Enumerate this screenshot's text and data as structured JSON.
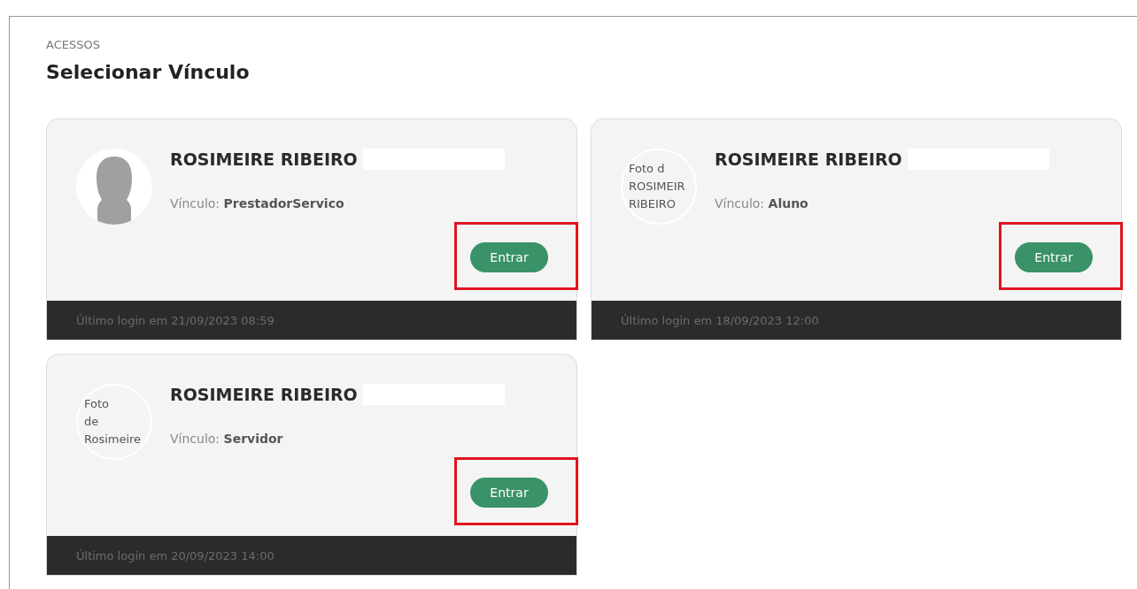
{
  "breadcrumb": "ACESSOS",
  "title": "Selecionar Vínculo",
  "cards": [
    {
      "name": "ROSIMEIRE RIBEIRO",
      "avatar": {
        "kind": "silhouette"
      },
      "link_label": "Vínculo:",
      "link_value": "PrestadorServico",
      "button": "Entrar",
      "highlighted": true,
      "last_login": "Último login em 21/09/2023 08:59"
    },
    {
      "name": "ROSIMEIRE RIBEIRO",
      "avatar": {
        "kind": "broken-image",
        "alt_lines": [
          "Foto d",
          "ROSIMEIR",
          "RIBEIRO"
        ]
      },
      "link_label": "Vínculo:",
      "link_value": "Aluno",
      "button": "Entrar",
      "highlighted": true,
      "last_login": "Último login em 18/09/2023 12:00"
    },
    {
      "name": "ROSIMEIRE RIBEIRO",
      "avatar": {
        "kind": "broken-image",
        "alt_lines": [
          "Foto",
          "de",
          "Rosimeire"
        ]
      },
      "link_label": "Vínculo:",
      "link_value": "Servidor",
      "button": "Entrar",
      "highlighted": true,
      "last_login": "Último login em 20/09/2023 14:00"
    }
  ]
}
